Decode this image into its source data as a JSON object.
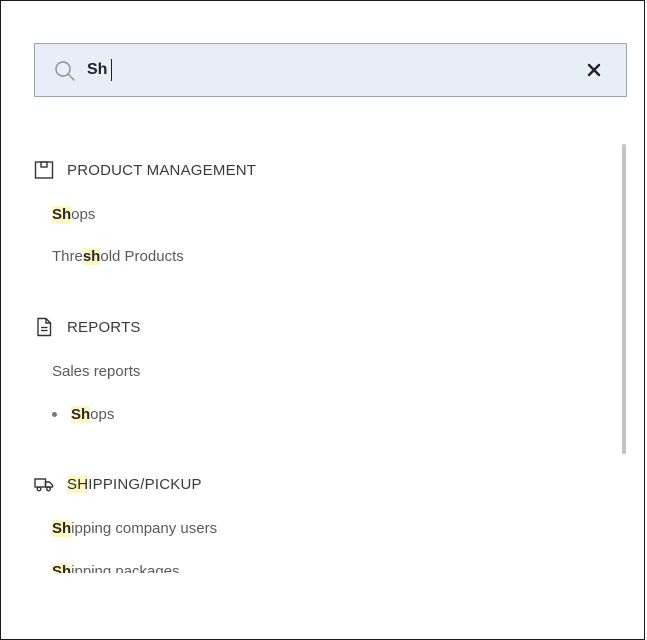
{
  "search": {
    "query_highlight": "Sh",
    "query_rest": ""
  },
  "groups": [
    {
      "icon": "product-box-icon",
      "label": "PRODUCT MANAGEMENT",
      "items": [
        {
          "hl": "Sh",
          "pre": "",
          "post": "ops",
          "bulleted": false
        },
        {
          "hl": "sh",
          "pre": "Thre",
          "post": "old Products",
          "bulleted": false
        }
      ]
    },
    {
      "icon": "document-icon",
      "label": "REPORTS",
      "items": [
        {
          "hl": "",
          "pre": "Sales reports",
          "post": "",
          "bulleted": false
        },
        {
          "hl": "Sh",
          "pre": "",
          "post": "ops",
          "bulleted": true
        }
      ]
    },
    {
      "icon": "truck-icon",
      "label_hl": "SH",
      "label_rest": "IPPING/PICKUP",
      "items": [
        {
          "hl": "Sh",
          "pre": "",
          "post": "ipping company users",
          "bulleted": false
        },
        {
          "hl": "Sh",
          "pre": "",
          "post": "ipping packages",
          "bulleted": false
        }
      ]
    }
  ]
}
